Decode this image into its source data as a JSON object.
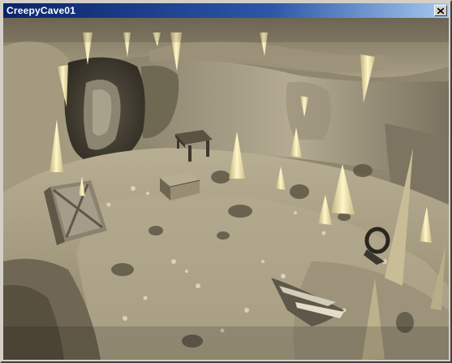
{
  "window": {
    "title": "CreepyCave01",
    "close_icon": "close-x-icon"
  },
  "scene": {
    "description_icon": "3d-cave-viewport",
    "colors": {
      "rock_light": "#c9c0a3",
      "rock_mid": "#9a927a",
      "rock_dark": "#4a4436",
      "stalactite": "#f2e6b0",
      "titlebar_start": "#0a246a",
      "titlebar_end": "#a6caf0"
    }
  }
}
